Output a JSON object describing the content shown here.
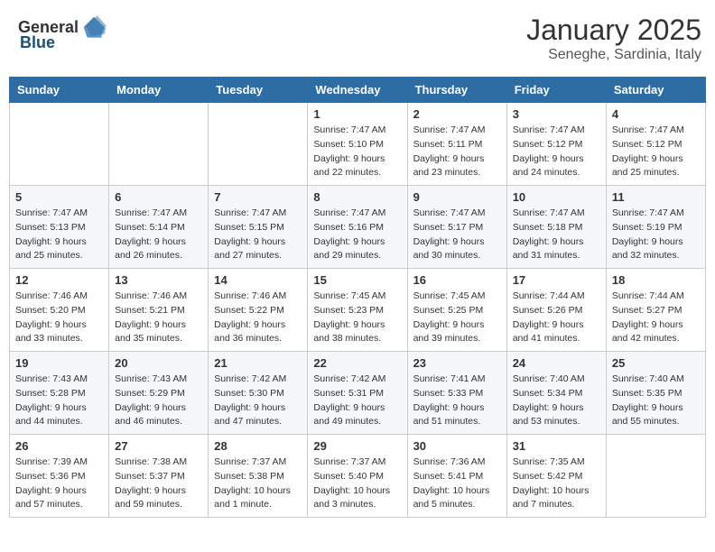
{
  "header": {
    "logo_general": "General",
    "logo_blue": "Blue",
    "month_title": "January 2025",
    "location": "Seneghe, Sardinia, Italy"
  },
  "weekdays": [
    "Sunday",
    "Monday",
    "Tuesday",
    "Wednesday",
    "Thursday",
    "Friday",
    "Saturday"
  ],
  "weeks": [
    [
      {
        "day": "",
        "info": ""
      },
      {
        "day": "",
        "info": ""
      },
      {
        "day": "",
        "info": ""
      },
      {
        "day": "1",
        "info": "Sunrise: 7:47 AM\nSunset: 5:10 PM\nDaylight: 9 hours\nand 22 minutes."
      },
      {
        "day": "2",
        "info": "Sunrise: 7:47 AM\nSunset: 5:11 PM\nDaylight: 9 hours\nand 23 minutes."
      },
      {
        "day": "3",
        "info": "Sunrise: 7:47 AM\nSunset: 5:12 PM\nDaylight: 9 hours\nand 24 minutes."
      },
      {
        "day": "4",
        "info": "Sunrise: 7:47 AM\nSunset: 5:12 PM\nDaylight: 9 hours\nand 25 minutes."
      }
    ],
    [
      {
        "day": "5",
        "info": "Sunrise: 7:47 AM\nSunset: 5:13 PM\nDaylight: 9 hours\nand 25 minutes."
      },
      {
        "day": "6",
        "info": "Sunrise: 7:47 AM\nSunset: 5:14 PM\nDaylight: 9 hours\nand 26 minutes."
      },
      {
        "day": "7",
        "info": "Sunrise: 7:47 AM\nSunset: 5:15 PM\nDaylight: 9 hours\nand 27 minutes."
      },
      {
        "day": "8",
        "info": "Sunrise: 7:47 AM\nSunset: 5:16 PM\nDaylight: 9 hours\nand 29 minutes."
      },
      {
        "day": "9",
        "info": "Sunrise: 7:47 AM\nSunset: 5:17 PM\nDaylight: 9 hours\nand 30 minutes."
      },
      {
        "day": "10",
        "info": "Sunrise: 7:47 AM\nSunset: 5:18 PM\nDaylight: 9 hours\nand 31 minutes."
      },
      {
        "day": "11",
        "info": "Sunrise: 7:47 AM\nSunset: 5:19 PM\nDaylight: 9 hours\nand 32 minutes."
      }
    ],
    [
      {
        "day": "12",
        "info": "Sunrise: 7:46 AM\nSunset: 5:20 PM\nDaylight: 9 hours\nand 33 minutes."
      },
      {
        "day": "13",
        "info": "Sunrise: 7:46 AM\nSunset: 5:21 PM\nDaylight: 9 hours\nand 35 minutes."
      },
      {
        "day": "14",
        "info": "Sunrise: 7:46 AM\nSunset: 5:22 PM\nDaylight: 9 hours\nand 36 minutes."
      },
      {
        "day": "15",
        "info": "Sunrise: 7:45 AM\nSunset: 5:23 PM\nDaylight: 9 hours\nand 38 minutes."
      },
      {
        "day": "16",
        "info": "Sunrise: 7:45 AM\nSunset: 5:25 PM\nDaylight: 9 hours\nand 39 minutes."
      },
      {
        "day": "17",
        "info": "Sunrise: 7:44 AM\nSunset: 5:26 PM\nDaylight: 9 hours\nand 41 minutes."
      },
      {
        "day": "18",
        "info": "Sunrise: 7:44 AM\nSunset: 5:27 PM\nDaylight: 9 hours\nand 42 minutes."
      }
    ],
    [
      {
        "day": "19",
        "info": "Sunrise: 7:43 AM\nSunset: 5:28 PM\nDaylight: 9 hours\nand 44 minutes."
      },
      {
        "day": "20",
        "info": "Sunrise: 7:43 AM\nSunset: 5:29 PM\nDaylight: 9 hours\nand 46 minutes."
      },
      {
        "day": "21",
        "info": "Sunrise: 7:42 AM\nSunset: 5:30 PM\nDaylight: 9 hours\nand 47 minutes."
      },
      {
        "day": "22",
        "info": "Sunrise: 7:42 AM\nSunset: 5:31 PM\nDaylight: 9 hours\nand 49 minutes."
      },
      {
        "day": "23",
        "info": "Sunrise: 7:41 AM\nSunset: 5:33 PM\nDaylight: 9 hours\nand 51 minutes."
      },
      {
        "day": "24",
        "info": "Sunrise: 7:40 AM\nSunset: 5:34 PM\nDaylight: 9 hours\nand 53 minutes."
      },
      {
        "day": "25",
        "info": "Sunrise: 7:40 AM\nSunset: 5:35 PM\nDaylight: 9 hours\nand 55 minutes."
      }
    ],
    [
      {
        "day": "26",
        "info": "Sunrise: 7:39 AM\nSunset: 5:36 PM\nDaylight: 9 hours\nand 57 minutes."
      },
      {
        "day": "27",
        "info": "Sunrise: 7:38 AM\nSunset: 5:37 PM\nDaylight: 9 hours\nand 59 minutes."
      },
      {
        "day": "28",
        "info": "Sunrise: 7:37 AM\nSunset: 5:38 PM\nDaylight: 10 hours\nand 1 minute."
      },
      {
        "day": "29",
        "info": "Sunrise: 7:37 AM\nSunset: 5:40 PM\nDaylight: 10 hours\nand 3 minutes."
      },
      {
        "day": "30",
        "info": "Sunrise: 7:36 AM\nSunset: 5:41 PM\nDaylight: 10 hours\nand 5 minutes."
      },
      {
        "day": "31",
        "info": "Sunrise: 7:35 AM\nSunset: 5:42 PM\nDaylight: 10 hours\nand 7 minutes."
      },
      {
        "day": "",
        "info": ""
      }
    ]
  ]
}
